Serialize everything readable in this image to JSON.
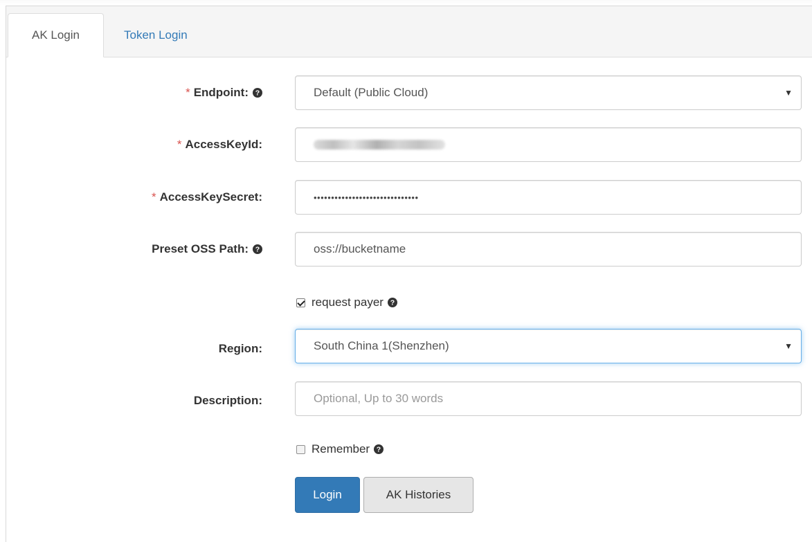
{
  "tabs": [
    {
      "label": "AK Login",
      "active": true
    },
    {
      "label": "Token Login",
      "active": false
    }
  ],
  "form": {
    "endpoint": {
      "label": "Endpoint:",
      "required": true,
      "has_help": true,
      "value": "Default (Public Cloud)"
    },
    "access_key_id": {
      "label": "AccessKeyId:",
      "required": true,
      "value_obscured": true
    },
    "access_key_secret": {
      "label": "AccessKeySecret:",
      "required": true,
      "value": "••••••••••••••••••••••••••••••"
    },
    "preset_oss_path": {
      "label": "Preset OSS Path:",
      "has_help": true,
      "value": "oss://bucketname"
    },
    "request_payer": {
      "label": "request payer",
      "checked": true,
      "has_help": true
    },
    "region": {
      "label": "Region:",
      "value": "South China 1(Shenzhen)",
      "focused": true
    },
    "description": {
      "label": "Description:",
      "placeholder": "Optional, Up to 30 words",
      "value": ""
    },
    "remember": {
      "label": "Remember",
      "checked": false,
      "has_help": true
    }
  },
  "buttons": {
    "login": "Login",
    "ak_histories": "AK Histories"
  },
  "required_marker": "*",
  "colors": {
    "primary": "#337ab7",
    "required": "#d9534f",
    "focus": "#66afe9"
  }
}
